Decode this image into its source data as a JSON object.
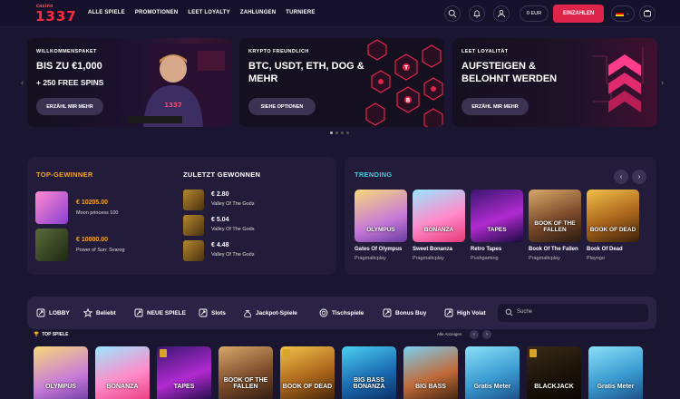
{
  "header": {
    "logo_small": "casino",
    "logo_big": "1337",
    "nav": [
      "ALLE SPIELE",
      "PROMOTIONEN",
      "LEET LOYALTY",
      "ZAHLUNGEN",
      "TURNIERE"
    ],
    "balance": "0 EUR",
    "deposit_label": "EINZAHLEN"
  },
  "banners": [
    {
      "kicker": "WILLKOMMENSPAKET",
      "title": "BIS ZU €1,000",
      "title2": "+ 250 FREE SPINS",
      "button": "ERZÄHL MIR MEHR"
    },
    {
      "kicker": "KRYPTO FREUNDLICH",
      "title": "BTC, USDT, ETH, DOG & MEHR",
      "button": "SIEHE OPTIONEN"
    },
    {
      "kicker": "LEET LOYALITÄT",
      "title": "AUFSTEIGEN & BELOHNT WERDEN",
      "button": "ERZÄHL MIR MEHR"
    }
  ],
  "winners": {
    "top_title": "TOP-GEWINNER",
    "recent_title": "ZULETZT GEWONNEN",
    "top": [
      {
        "amount": "€ 10205.00",
        "game": "Moon princess 100",
        "thumb": "Moon Princess"
      },
      {
        "amount": "€ 10000.00",
        "game": "Power of Sun: Svarog",
        "thumb": "SVAROG"
      }
    ],
    "recent": [
      {
        "amount": "€ 2.80",
        "game": "Valley Of The Gods"
      },
      {
        "amount": "€ 5.04",
        "game": "Valley Of The Gods"
      },
      {
        "amount": "€ 4.48",
        "game": "Valley Of The Gods"
      }
    ]
  },
  "trending": {
    "title": "TRENDING",
    "games": [
      {
        "name": "Gates Of Olympus",
        "provider": "Pragmaticplay",
        "label": "OLYMPUS"
      },
      {
        "name": "Sweet Bonanza",
        "provider": "Pragmaticplay",
        "label": "BONANZA"
      },
      {
        "name": "Retro Tapes",
        "provider": "Pushgaming",
        "label": "TAPES"
      },
      {
        "name": "Book Of The Fallen",
        "provider": "Pragmaticplay",
        "label": "BOOK OF THE FALLEN"
      },
      {
        "name": "Book Of Dead",
        "provider": "Playngo",
        "label": "BOOK OF DEAD"
      }
    ]
  },
  "categories": [
    "LOBBY",
    "Beliebt",
    "NEUE SPIELE",
    "Slots",
    "Jackpot-Spiele",
    "Tischspiele",
    "Bonus Buy",
    "High Volat"
  ],
  "search_placeholder": "Suche",
  "top_games_label": "TOP SPIELE",
  "show_all_label": "Alle Anzeigen",
  "top_games": [
    "OLYMPUS",
    "BONANZA",
    "TAPES",
    "BOOK OF THE FALLEN",
    "BOOK OF DEAD",
    "BIG BASS BONANZA",
    "BIG BASS",
    "Gratis Meter",
    "BLACKJACK",
    "Gratis Meter"
  ]
}
